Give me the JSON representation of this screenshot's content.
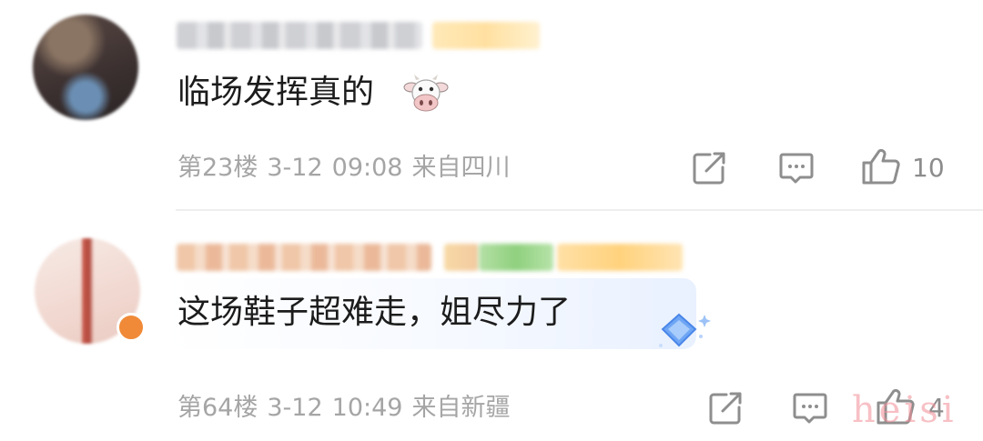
{
  "comments": [
    {
      "text": "临场发挥真的",
      "emoji": "cow-face",
      "floor": "第23楼",
      "date": "3-12",
      "time": "09:08",
      "location": "来自四川",
      "likes": "10"
    },
    {
      "text": "这场鞋子超难走，姐尽力了",
      "floor": "第64楼",
      "date": "3-12",
      "time": "10:49",
      "location": "来自新疆",
      "likes": "4"
    }
  ],
  "icons": {
    "share": "share-icon",
    "reply": "comment-icon",
    "like": "thumbs-up-icon"
  },
  "watermark": "heisi",
  "colors": {
    "meta_text": "#a5a5a5",
    "body_text": "#1c1c1c",
    "icon_stroke": "#8e8e8e"
  }
}
